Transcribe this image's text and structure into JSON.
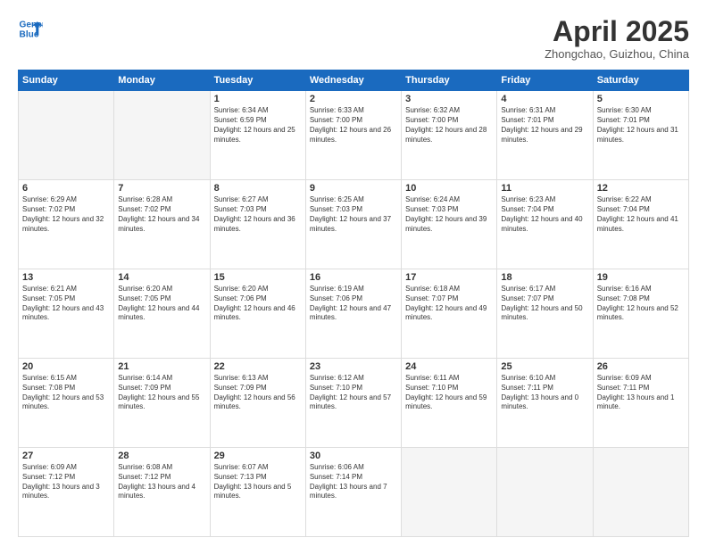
{
  "header": {
    "logo_line1": "General",
    "logo_line2": "Blue",
    "title": "April 2025",
    "subtitle": "Zhongchao, Guizhou, China"
  },
  "weekdays": [
    "Sunday",
    "Monday",
    "Tuesday",
    "Wednesday",
    "Thursday",
    "Friday",
    "Saturday"
  ],
  "rows": [
    [
      {
        "day": "",
        "empty": true
      },
      {
        "day": "",
        "empty": true
      },
      {
        "day": "1",
        "sunrise": "6:34 AM",
        "sunset": "6:59 PM",
        "daylight": "12 hours and 25 minutes."
      },
      {
        "day": "2",
        "sunrise": "6:33 AM",
        "sunset": "7:00 PM",
        "daylight": "12 hours and 26 minutes."
      },
      {
        "day": "3",
        "sunrise": "6:32 AM",
        "sunset": "7:00 PM",
        "daylight": "12 hours and 28 minutes."
      },
      {
        "day": "4",
        "sunrise": "6:31 AM",
        "sunset": "7:01 PM",
        "daylight": "12 hours and 29 minutes."
      },
      {
        "day": "5",
        "sunrise": "6:30 AM",
        "sunset": "7:01 PM",
        "daylight": "12 hours and 31 minutes."
      }
    ],
    [
      {
        "day": "6",
        "sunrise": "6:29 AM",
        "sunset": "7:02 PM",
        "daylight": "12 hours and 32 minutes."
      },
      {
        "day": "7",
        "sunrise": "6:28 AM",
        "sunset": "7:02 PM",
        "daylight": "12 hours and 34 minutes."
      },
      {
        "day": "8",
        "sunrise": "6:27 AM",
        "sunset": "7:03 PM",
        "daylight": "12 hours and 36 minutes."
      },
      {
        "day": "9",
        "sunrise": "6:25 AM",
        "sunset": "7:03 PM",
        "daylight": "12 hours and 37 minutes."
      },
      {
        "day": "10",
        "sunrise": "6:24 AM",
        "sunset": "7:03 PM",
        "daylight": "12 hours and 39 minutes."
      },
      {
        "day": "11",
        "sunrise": "6:23 AM",
        "sunset": "7:04 PM",
        "daylight": "12 hours and 40 minutes."
      },
      {
        "day": "12",
        "sunrise": "6:22 AM",
        "sunset": "7:04 PM",
        "daylight": "12 hours and 41 minutes."
      }
    ],
    [
      {
        "day": "13",
        "sunrise": "6:21 AM",
        "sunset": "7:05 PM",
        "daylight": "12 hours and 43 minutes."
      },
      {
        "day": "14",
        "sunrise": "6:20 AM",
        "sunset": "7:05 PM",
        "daylight": "12 hours and 44 minutes."
      },
      {
        "day": "15",
        "sunrise": "6:20 AM",
        "sunset": "7:06 PM",
        "daylight": "12 hours and 46 minutes."
      },
      {
        "day": "16",
        "sunrise": "6:19 AM",
        "sunset": "7:06 PM",
        "daylight": "12 hours and 47 minutes."
      },
      {
        "day": "17",
        "sunrise": "6:18 AM",
        "sunset": "7:07 PM",
        "daylight": "12 hours and 49 minutes."
      },
      {
        "day": "18",
        "sunrise": "6:17 AM",
        "sunset": "7:07 PM",
        "daylight": "12 hours and 50 minutes."
      },
      {
        "day": "19",
        "sunrise": "6:16 AM",
        "sunset": "7:08 PM",
        "daylight": "12 hours and 52 minutes."
      }
    ],
    [
      {
        "day": "20",
        "sunrise": "6:15 AM",
        "sunset": "7:08 PM",
        "daylight": "12 hours and 53 minutes."
      },
      {
        "day": "21",
        "sunrise": "6:14 AM",
        "sunset": "7:09 PM",
        "daylight": "12 hours and 55 minutes."
      },
      {
        "day": "22",
        "sunrise": "6:13 AM",
        "sunset": "7:09 PM",
        "daylight": "12 hours and 56 minutes."
      },
      {
        "day": "23",
        "sunrise": "6:12 AM",
        "sunset": "7:10 PM",
        "daylight": "12 hours and 57 minutes."
      },
      {
        "day": "24",
        "sunrise": "6:11 AM",
        "sunset": "7:10 PM",
        "daylight": "12 hours and 59 minutes."
      },
      {
        "day": "25",
        "sunrise": "6:10 AM",
        "sunset": "7:11 PM",
        "daylight": "13 hours and 0 minutes."
      },
      {
        "day": "26",
        "sunrise": "6:09 AM",
        "sunset": "7:11 PM",
        "daylight": "13 hours and 1 minute."
      }
    ],
    [
      {
        "day": "27",
        "sunrise": "6:09 AM",
        "sunset": "7:12 PM",
        "daylight": "13 hours and 3 minutes."
      },
      {
        "day": "28",
        "sunrise": "6:08 AM",
        "sunset": "7:12 PM",
        "daylight": "13 hours and 4 minutes."
      },
      {
        "day": "29",
        "sunrise": "6:07 AM",
        "sunset": "7:13 PM",
        "daylight": "13 hours and 5 minutes."
      },
      {
        "day": "30",
        "sunrise": "6:06 AM",
        "sunset": "7:14 PM",
        "daylight": "13 hours and 7 minutes."
      },
      {
        "day": "",
        "empty": true
      },
      {
        "day": "",
        "empty": true
      },
      {
        "day": "",
        "empty": true
      }
    ]
  ]
}
